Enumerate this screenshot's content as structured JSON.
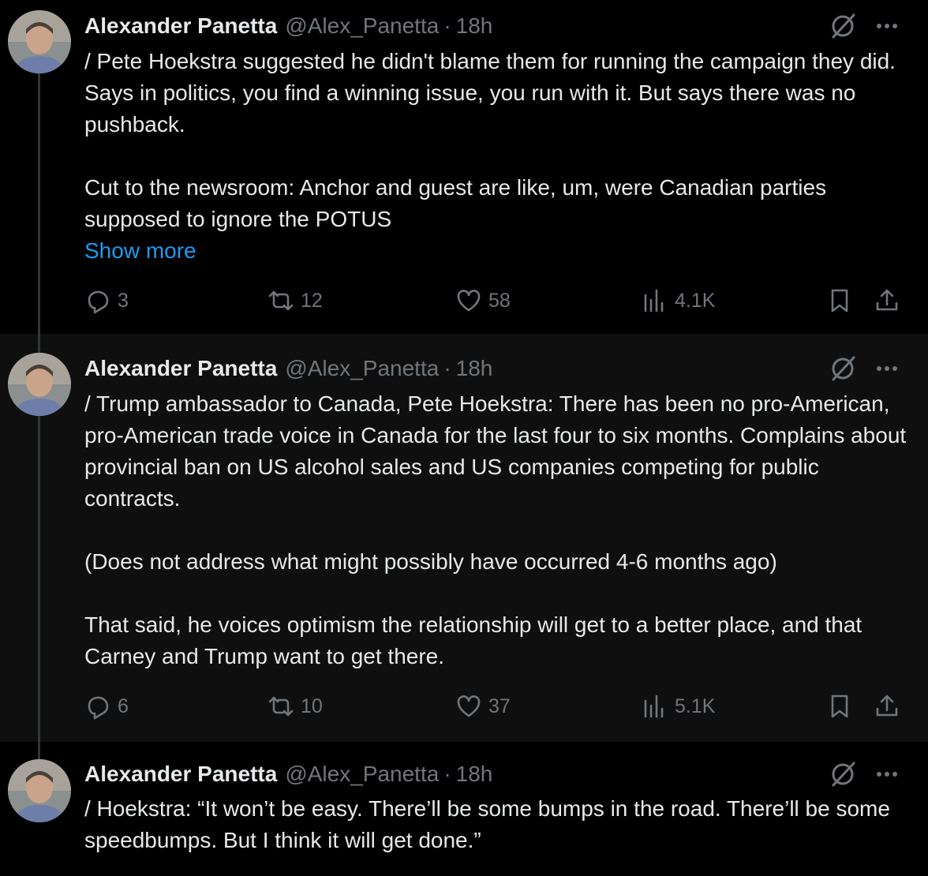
{
  "tweets": [
    {
      "name": "Alexander Panetta",
      "handle": "@Alex_Panetta",
      "separator": "·",
      "time": "18h",
      "text": "/ Pete Hoekstra suggested he didn't blame them for running the campaign they did. Says in politics, you find a winning issue, you run with it. But says there was no pushback.\n\nCut to the newsroom: Anchor and guest are like, um, were Canadian parties supposed to ignore the POTUS",
      "show_more": "Show more",
      "replies": "3",
      "reposts": "12",
      "likes": "58",
      "views": "4.1K"
    },
    {
      "name": "Alexander Panetta",
      "handle": "@Alex_Panetta",
      "separator": "·",
      "time": "18h",
      "text": "/ Trump ambassador to Canada, Pete Hoekstra: There has been no pro-American, pro-American trade voice in Canada for the last four to six months. Complains about provincial ban on US alcohol sales and US companies competing for public contracts.\n\n(Does not address what might possibly have occurred 4-6 months ago)\n\nThat said, he voices optimism the relationship will get to a better place, and that Carney and Trump want to get there.",
      "replies": "6",
      "reposts": "10",
      "likes": "37",
      "views": "5.1K"
    },
    {
      "name": "Alexander Panetta",
      "handle": "@Alex_Panetta",
      "separator": "·",
      "time": "18h",
      "text": "/ Hoekstra: “It won’t be easy. There’ll be some bumps in the road. There’ll be some speedbumps. But I think it will get done.”"
    }
  ],
  "icons": {
    "reply": "reply-icon",
    "repost": "repost-icon",
    "like": "heart-icon",
    "views": "views-icon",
    "bookmark": "bookmark-icon",
    "share": "share-icon",
    "grok": "grok-icon",
    "more": "more-icon"
  },
  "colors": {
    "background": "#000000",
    "highlight_background": "#0f0f0f",
    "text": "#e7e9ea",
    "secondary": "#71767b",
    "link": "#1d9bf0"
  }
}
